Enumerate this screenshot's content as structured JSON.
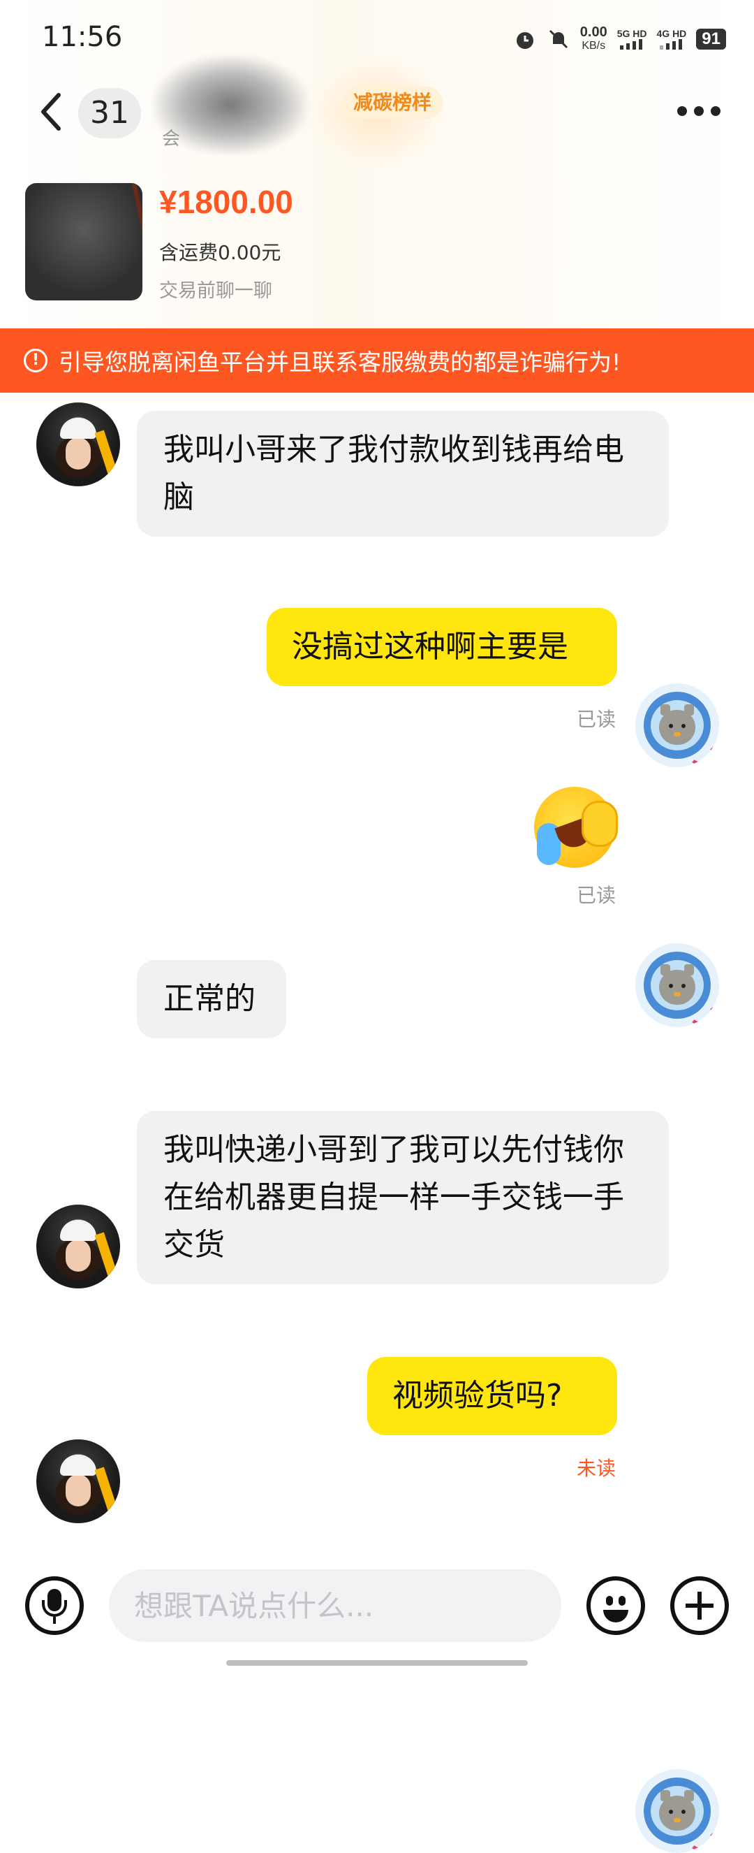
{
  "status_bar": {
    "time": "11:56",
    "net_speed_value": "0.00",
    "net_speed_unit": "KB/s",
    "sim1": "5G HD",
    "sim2": "4G HD",
    "battery": "91",
    "icons": [
      "alarm-icon",
      "mute-bell-icon",
      "signal-icon",
      "battery-icon"
    ]
  },
  "header": {
    "unread_count": "31",
    "tag": "减碳榜样",
    "sub_char": "会",
    "icons": [
      "back-arrow-icon",
      "more-icon"
    ]
  },
  "product": {
    "price": "¥1800.00",
    "shipping": "含运费0.00元",
    "hint": "交易前聊一聊"
  },
  "warning": {
    "text": "引导您脱离闲鱼平台并且联系客服缴费的都是诈骗行为!",
    "color": "#ff5722"
  },
  "messages": [
    {
      "from": "other",
      "text": "我叫小哥来了我付款收到钱再给电脑"
    },
    {
      "from": "me",
      "text": "没搞过这种啊主要是",
      "status": "已读"
    },
    {
      "from": "me",
      "emoji": "crying-laughing-emoji",
      "status": "已读"
    },
    {
      "from": "other",
      "text": "正常的"
    },
    {
      "from": "other",
      "text": "我叫快递小哥到了我可以先付钱你在给机器更自提一样一手交钱一手交货"
    },
    {
      "from": "me",
      "text": "视频验货吗?",
      "status": "未读"
    }
  ],
  "composer": {
    "placeholder": "想跟TA说点什么...",
    "icons": [
      "microphone-icon",
      "emoji-icon",
      "plus-icon"
    ]
  },
  "colors": {
    "accent": "#ff5722",
    "my_bubble": "#ffe60f",
    "their_bubble": "#f1f1f3"
  }
}
